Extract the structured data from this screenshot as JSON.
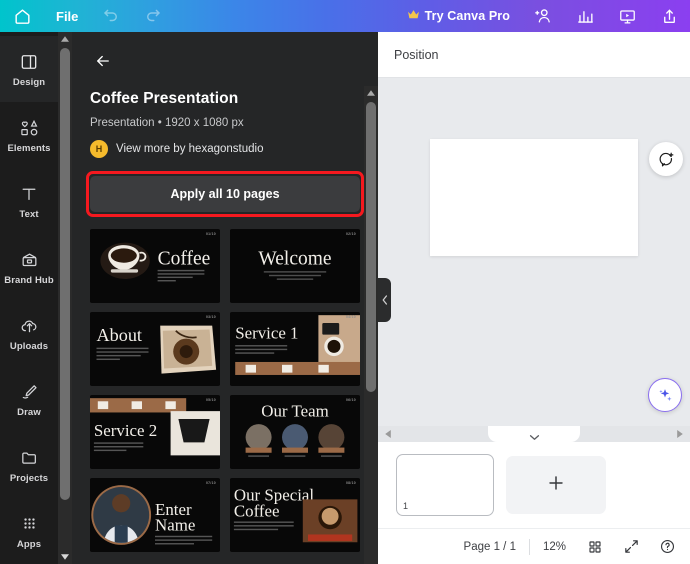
{
  "topbar": {
    "home_icon": "home-icon",
    "file_label": "File",
    "undo_icon": "undo-icon",
    "redo_icon": "redo-icon",
    "pro_label": "Try Canva Pro",
    "crown_icon": "crown-icon",
    "share_people_icon": "add-person-icon",
    "insights_icon": "bar-chart-icon",
    "present_icon": "present-icon",
    "upload_icon": "upload-icon",
    "gradient_start": "#00c4cc",
    "gradient_end": "#8b3ff0"
  },
  "rail": {
    "items": [
      {
        "label": "Design",
        "icon": "design-icon",
        "active": true
      },
      {
        "label": "Elements",
        "icon": "elements-icon",
        "active": false
      },
      {
        "label": "Text",
        "icon": "text-icon",
        "active": false
      },
      {
        "label": "Brand Hub",
        "icon": "brand-hub-icon",
        "active": false
      },
      {
        "label": "Uploads",
        "icon": "uploads-icon",
        "active": false
      },
      {
        "label": "Draw",
        "icon": "draw-icon",
        "active": false
      },
      {
        "label": "Projects",
        "icon": "projects-icon",
        "active": false
      },
      {
        "label": "Apps",
        "icon": "apps-icon",
        "active": false
      }
    ]
  },
  "panel": {
    "back_icon": "back-arrow-icon",
    "title": "Coffee Presentation",
    "meta": "Presentation • 1920 x 1080 px",
    "author_initial": "H",
    "author_link": "View more by hexagonstudio",
    "apply_label": "Apply all 10 pages",
    "highlight_color": "#f5191f",
    "thumbnails": [
      {
        "heading": "Coffee",
        "badge": "01/10"
      },
      {
        "heading": "Welcome",
        "badge": "02/10"
      },
      {
        "heading": "About",
        "badge": "03/10"
      },
      {
        "heading": "Service 1",
        "badge": "04/10"
      },
      {
        "heading": "Service 2",
        "badge": "05/10"
      },
      {
        "heading": "Our Team",
        "badge": "06/10"
      },
      {
        "heading": "Enter Name",
        "badge": "07/10"
      },
      {
        "heading": "Our Special Coffee",
        "badge": "08/10"
      }
    ]
  },
  "editor": {
    "position_label": "Position",
    "comment_icon": "add-comment-icon",
    "magic_icon": "magic-sparkle-icon",
    "collapse_icon": "chevron-left-icon",
    "scroll_left_icon": "chevron-left-small-icon",
    "scroll_right_icon": "chevron-right-small-icon",
    "pages_tab_icon": "chevron-down-icon",
    "page_number": "1",
    "add_page_icon": "plus-icon",
    "status": {
      "page_indicator": "Page 1 / 1",
      "zoom": "12%",
      "grid_icon": "grid-view-icon",
      "fullscreen_icon": "fullscreen-icon",
      "help_icon": "help-icon"
    }
  }
}
